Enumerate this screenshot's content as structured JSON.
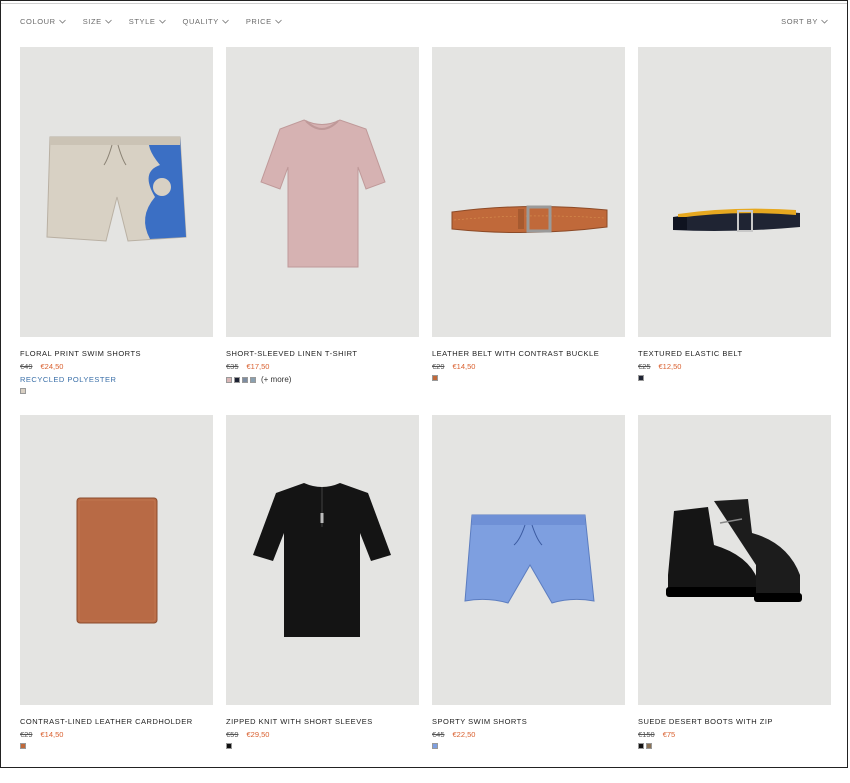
{
  "filters": [
    {
      "label": "COLOUR"
    },
    {
      "label": "SIZE"
    },
    {
      "label": "STYLE"
    },
    {
      "label": "QUALITY"
    },
    {
      "label": "PRICE"
    }
  ],
  "sort": {
    "label": "SORT BY"
  },
  "products": [
    {
      "name": "FLORAL PRINT SWIM SHORTS",
      "old_price": "€49",
      "new_price": "€24,50",
      "tag": "RECYCLED POLYESTER",
      "swatches": [
        "#d8cfc2"
      ],
      "more": ""
    },
    {
      "name": "SHORT-SLEEVED LINEN T-SHIRT",
      "old_price": "€35",
      "new_price": "€17,50",
      "tag": "",
      "swatches": [
        "#d9b7b7",
        "#1d2233",
        "#7d8ca0",
        "#8aa0b0"
      ],
      "more": "(+ more)"
    },
    {
      "name": "LEATHER BELT WITH CONTRAST BUCKLE",
      "old_price": "€29",
      "new_price": "€14,50",
      "tag": "",
      "swatches": [
        "#c0693a"
      ],
      "more": ""
    },
    {
      "name": "TEXTURED ELASTIC BELT",
      "old_price": "€25",
      "new_price": "€12,50",
      "tag": "",
      "swatches": [
        "#1f2433"
      ],
      "more": ""
    },
    {
      "name": "CONTRAST-LINED LEATHER CARDHOLDER",
      "old_price": "€29",
      "new_price": "€14,50",
      "tag": "",
      "swatches": [
        "#c0693a"
      ],
      "more": ""
    },
    {
      "name": "ZIPPED KNIT WITH SHORT SLEEVES",
      "old_price": "€59",
      "new_price": "€29,50",
      "tag": "",
      "swatches": [
        "#111111"
      ],
      "more": ""
    },
    {
      "name": "SPORTY SWIM SHORTS",
      "old_price": "€45",
      "new_price": "€22,50",
      "tag": "",
      "swatches": [
        "#7e9fe0"
      ],
      "more": ""
    },
    {
      "name": "SUEDE DESERT BOOTS WITH ZIP",
      "old_price": "€150",
      "new_price": "€75",
      "tag": "",
      "swatches": [
        "#111111",
        "#8a7256"
      ],
      "more": ""
    }
  ],
  "colors": {
    "accent_price": "#d9602f",
    "tag_blue": "#3a6fa8",
    "photo_bg": "#e4e4e2"
  }
}
